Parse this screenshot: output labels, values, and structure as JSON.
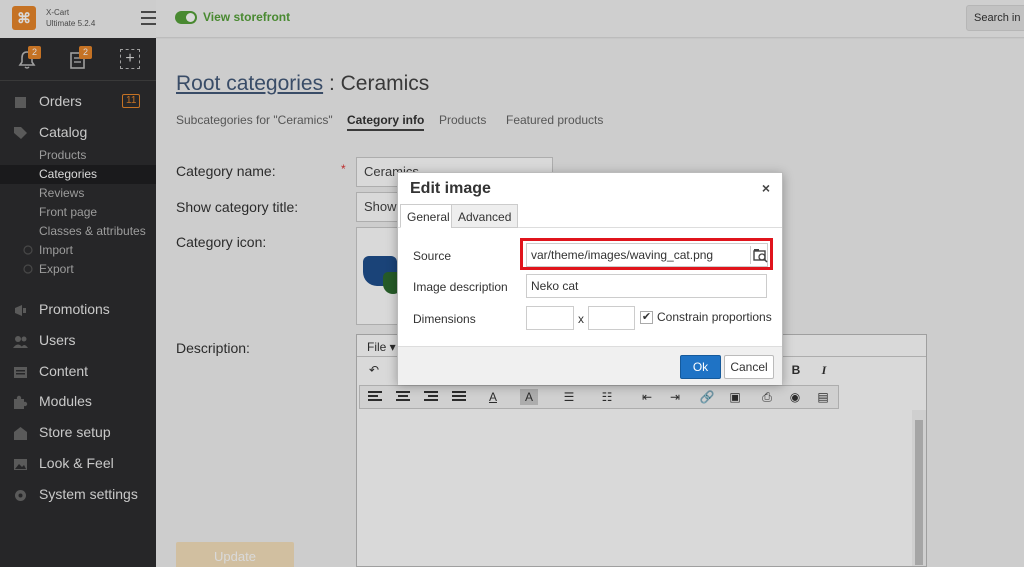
{
  "brand": {
    "name_line1": "X-Cart",
    "name_line2": "Ultimate 5.2.4"
  },
  "header": {
    "storefront_label": "View storefront",
    "search_placeholder": "Search in"
  },
  "quickbar": {
    "notifications_count": "2",
    "orders_count": "2"
  },
  "sidebar": {
    "orders": {
      "label": "Orders",
      "badge": "11"
    },
    "catalog": {
      "label": "Catalog"
    },
    "catalog_items": [
      {
        "label": "Products"
      },
      {
        "label": "Categories"
      },
      {
        "label": "Reviews"
      },
      {
        "label": "Front page"
      },
      {
        "label": "Classes & attributes"
      },
      {
        "label": "Import"
      },
      {
        "label": "Export"
      }
    ],
    "sections": [
      {
        "label": "Promotions"
      },
      {
        "label": "Users"
      },
      {
        "label": "Content"
      },
      {
        "label": "Modules"
      },
      {
        "label": "Store setup"
      },
      {
        "label": "Look & Feel"
      },
      {
        "label": "System settings"
      }
    ]
  },
  "page": {
    "root_link": "Root categories",
    "title_suffix": ": Ceramics",
    "tabs": [
      {
        "label": "Subcategories for \"Ceramics\""
      },
      {
        "label": "Category info"
      },
      {
        "label": "Products"
      },
      {
        "label": "Featured products"
      }
    ]
  },
  "form": {
    "category_name_label": "Category name:",
    "required_mark": "*",
    "category_name_value": "Ceramics",
    "show_title_label": "Show category title:",
    "show_title_value": "Show",
    "icon_label": "Category icon:",
    "description_label": "Description:",
    "editor_file_menu": "File ▾",
    "update_button": "Update"
  },
  "modal": {
    "title": "Edit image",
    "close": "×",
    "tabs": [
      {
        "label": "General"
      },
      {
        "label": "Advanced"
      }
    ],
    "source_label": "Source",
    "source_value": "var/theme/images/waving_cat.png",
    "description_label": "Image description",
    "description_value": "Neko cat",
    "dimensions_label": "Dimensions",
    "dimensions_x": "x",
    "constrain_label": "Constrain proportions",
    "constrain_checked": "✔",
    "ok_button": "Ok",
    "cancel_button": "Cancel"
  },
  "colors": {
    "accent_orange": "#e8862b",
    "storefront_green": "#56a23a",
    "primary_blue": "#1f73c5",
    "highlight_red": "#e0141c",
    "sidebar_bg": "#2d2d2f"
  }
}
